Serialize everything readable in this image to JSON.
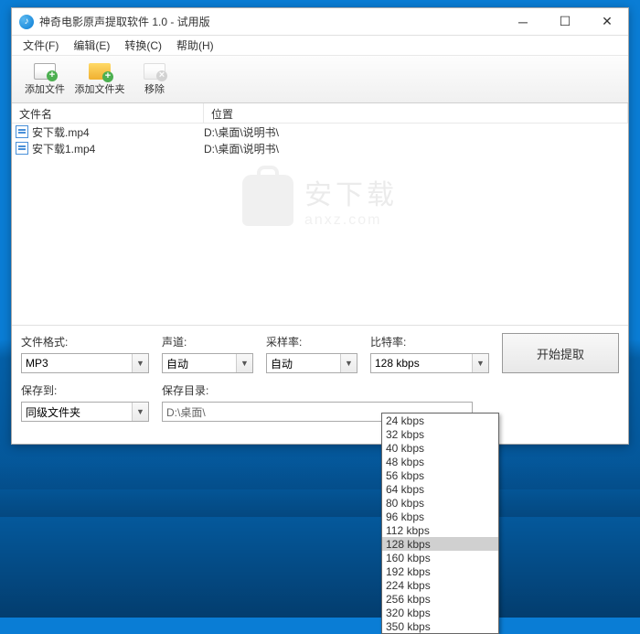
{
  "titlebar": {
    "title": "神奇电影原声提取软件 1.0 - 试用版"
  },
  "menubar": {
    "items": [
      "文件(F)",
      "编辑(E)",
      "转换(C)",
      "帮助(H)"
    ]
  },
  "toolbar": {
    "add_file": "添加文件",
    "add_folder": "添加文件夹",
    "remove": "移除"
  },
  "file_list": {
    "headers": {
      "name": "文件名",
      "location": "位置"
    },
    "rows": [
      {
        "name": "安下载.mp4",
        "location": "D:\\桌面\\说明书\\"
      },
      {
        "name": "安下载1.mp4",
        "location": "D:\\桌面\\说明书\\"
      }
    ]
  },
  "watermark": {
    "main": "安下载",
    "sub": "anxz.com"
  },
  "settings": {
    "format_label": "文件格式:",
    "format_value": "MP3",
    "channel_label": "声道:",
    "channel_value": "自动",
    "sample_label": "采样率:",
    "sample_value": "自动",
    "bitrate_label": "比特率:",
    "bitrate_value": "128 kbps",
    "saveto_label": "保存到:",
    "saveto_value": "同级文件夹",
    "savedir_label": "保存目录:",
    "savedir_value": "D:\\桌面\\",
    "start_button": "开始提取"
  },
  "bitrate_options": [
    "24 kbps",
    "32 kbps",
    "40 kbps",
    "48 kbps",
    "56 kbps",
    "64 kbps",
    "80 kbps",
    "96 kbps",
    "112 kbps",
    "128 kbps",
    "160 kbps",
    "192 kbps",
    "224 kbps",
    "256 kbps",
    "320 kbps",
    "350 kbps"
  ],
  "bitrate_selected": "128 kbps"
}
